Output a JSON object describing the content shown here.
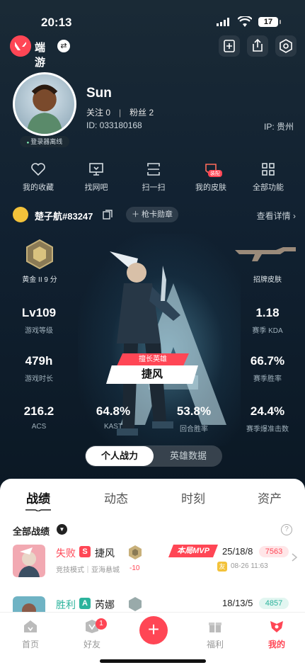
{
  "status": {
    "time": "20:13",
    "battery": "17"
  },
  "app": {
    "name": "端游"
  },
  "profile": {
    "name": "Sun",
    "following": "关注 0",
    "fans": "粉丝 2",
    "uid": "ID: 033180168",
    "ip": "IP: 贵州",
    "online_status": "登录器离线"
  },
  "shortcuts": [
    {
      "label": "我的收藏",
      "icon": "heart-icon"
    },
    {
      "label": "找网吧",
      "icon": "monitor-icon"
    },
    {
      "label": "扫一扫",
      "icon": "scan-icon"
    },
    {
      "label": "我的皮肤",
      "icon": "skin-icon",
      "badge": "装配"
    },
    {
      "label": "全部功能",
      "icon": "grid-icon"
    }
  ],
  "riot": {
    "id": "楚子航#83247",
    "gun_badge": "枪卡勋章",
    "detail": "查看详情"
  },
  "stats": {
    "rank": "黄金 II 9 分",
    "skin": "招牌皮肤",
    "level": {
      "value": "Lv109",
      "label": "游戏等级"
    },
    "kda": {
      "value": "1.18",
      "label": "赛季 KDA"
    },
    "hours": {
      "value": "479h",
      "label": "游戏时长"
    },
    "winrate": {
      "value": "66.7%",
      "label": "赛季胜率"
    },
    "acs": {
      "value": "216.2",
      "label": "ACS"
    },
    "kast": {
      "value": "64.8%",
      "label": "KAST"
    },
    "round_win": {
      "value": "53.8%",
      "label": "回合胜率"
    },
    "headshot": {
      "value": "24.4%",
      "label": "赛季爆准击数"
    }
  },
  "hero": {
    "tag": "擅长英雄",
    "name": "捷风"
  },
  "toggle": {
    "active": "个人战力",
    "inactive": "英雄数据"
  },
  "tabs": [
    "战绩",
    "动态",
    "时刻",
    "资产"
  ],
  "filter": {
    "label": "全部战绩"
  },
  "matches": [
    {
      "result": "失败",
      "role": "S",
      "agent": "捷风",
      "mode": "竞技模式｜亚海悬城",
      "rank_delta": "-10",
      "mvp": "本局MVP",
      "kda": "25/18/8",
      "score": "7563",
      "friend": "友",
      "time": "08-26 11:63",
      "accent": "#ff4655"
    },
    {
      "result": "胜利",
      "role": "A",
      "agent": "芮娜",
      "kda": "18/13/5",
      "score": "4857",
      "accent": "#2bb39c"
    }
  ],
  "nav": [
    {
      "label": "首页",
      "icon": "home-icon"
    },
    {
      "label": "好友",
      "icon": "friends-icon",
      "badge": "1"
    },
    {
      "label": "福利",
      "icon": "gift-icon"
    },
    {
      "label": "我的",
      "icon": "me-icon"
    }
  ],
  "colors": {
    "brand": "#ff4655",
    "win": "#2bb39c",
    "panel_bg": "#0f1923"
  }
}
